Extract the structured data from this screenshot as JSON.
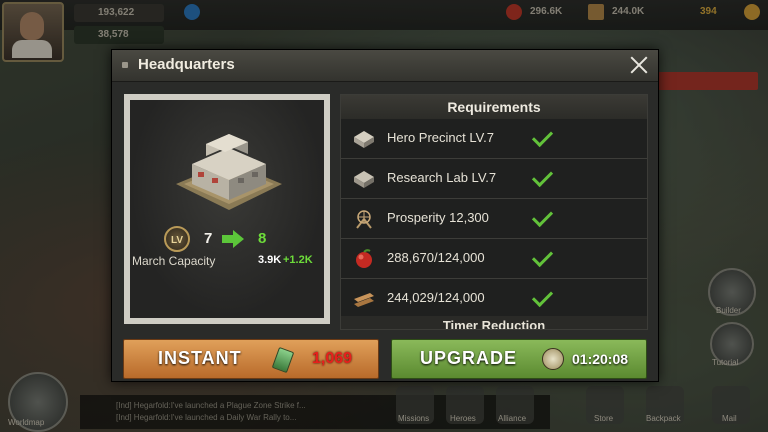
{
  "hud": {
    "power": "193,622",
    "power_secondary": "38,578",
    "resource_a": "296.6K",
    "resource_b": "244.0K",
    "resource_c": "394",
    "chat_line_1": "[Ind] Hegarfold:I've launched a Plague Zone Strike f...",
    "chat_line_2": "[Ind] Hegarfold:I've launched a Daily War Rally to...",
    "menu_labels": [
      "Missions",
      "Heroes",
      "Alliance",
      "Store",
      "Backpack",
      "Mail"
    ],
    "side_labels": [
      "Builder",
      "Tutorial"
    ],
    "bottom_left_label": "Worldmap"
  },
  "modal": {
    "title": "Headquarters",
    "level_badge": "LV",
    "level_from": "7",
    "level_to": "8",
    "capacity_label": "March Capacity",
    "capacity_value": "3.9K",
    "capacity_bonus": "+1.2K",
    "requirements_title": "Requirements",
    "requirements": [
      {
        "icon": "building-icon",
        "text": "Hero Precinct LV.7",
        "met": true
      },
      {
        "icon": "building-icon",
        "text": "Research Lab LV.7",
        "met": true
      },
      {
        "icon": "windmill-icon",
        "text": "Prosperity 12,300",
        "met": true
      },
      {
        "icon": "food-icon",
        "text": "288,670/124,000",
        "met": true
      },
      {
        "icon": "wood-icon",
        "text": "244,029/124,000",
        "met": true
      }
    ],
    "next_section": "Timer Reduction",
    "instant_label": "INSTANT",
    "instant_cost": "1,069",
    "upgrade_label": "UPGRADE",
    "upgrade_time": "01:20:08"
  },
  "colors": {
    "accent_green": "#6ddc3a",
    "cost_red": "#e6201c",
    "instant_orange": "#c9823c",
    "upgrade_green": "#6e9e42"
  }
}
